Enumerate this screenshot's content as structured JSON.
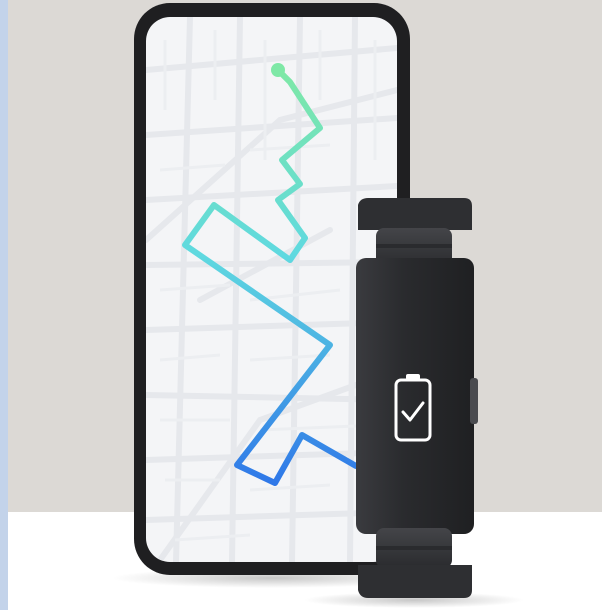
{
  "scene": {
    "subject": "",
    "colors": {
      "backdrop": "#dcd9d5",
      "floor": "#ffffff",
      "left_edge": "#c3d3ea",
      "phone_body": "#1f1f21",
      "phone_screen": "#f4f5f7",
      "map_roads": "#e6e8ec",
      "route_start": "#7ee8a6",
      "route_mid": "#5fd9e0",
      "route_end": "#2f78e8",
      "band": "#2a2b2e",
      "band_highlight": "#3a3b3f",
      "display_icon": "#ffffff"
    },
    "phone": {
      "icon": "map-route-icon"
    },
    "tracker": {
      "display_icon": "battery-check-icon"
    }
  }
}
